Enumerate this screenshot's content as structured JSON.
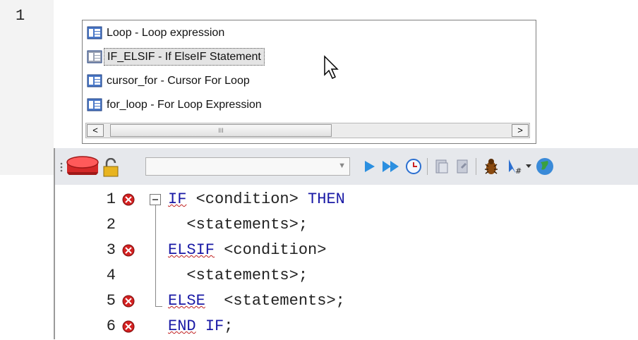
{
  "editor_top": {
    "line_number": "1"
  },
  "completion_list": {
    "items": [
      {
        "label": "Loop - Loop expression",
        "icon": "snippet-icon"
      },
      {
        "label": "IF_ELSIF - If ElseIF Statement",
        "icon": "snippet-icon",
        "selected": true
      },
      {
        "label": "cursor_for - Cursor For Loop",
        "icon": "snippet-icon"
      },
      {
        "label": "for_loop - For Loop Expression",
        "icon": "snippet-icon"
      }
    ],
    "scrollbar": {
      "left_arrow": "<",
      "right_arrow": ">",
      "thumb_grip": "III"
    }
  },
  "toolbar": {
    "icons": [
      "database-icon",
      "lock-icon",
      "run-icon",
      "run-all-icon",
      "history-icon",
      "commit-icon",
      "rollback-icon",
      "debug-bug-icon",
      "explain-plan-icon",
      "globe-icon"
    ],
    "combo_value": ""
  },
  "code_lines": [
    {
      "num": "1",
      "breakpoint": true,
      "parts": [
        {
          "t": "IF",
          "kw": true,
          "wavy": true
        },
        {
          "t": " <condition> "
        },
        {
          "t": "THEN",
          "kw": true
        }
      ]
    },
    {
      "num": "2",
      "breakpoint": false,
      "parts": [
        {
          "t": "  <statements>;"
        }
      ]
    },
    {
      "num": "3",
      "breakpoint": true,
      "parts": [
        {
          "t": "ELSIF",
          "kw": true,
          "wavy": true
        },
        {
          "t": " <condition>"
        }
      ]
    },
    {
      "num": "4",
      "breakpoint": false,
      "parts": [
        {
          "t": "  <statements>;"
        }
      ]
    },
    {
      "num": "5",
      "breakpoint": true,
      "parts": [
        {
          "t": "ELSE",
          "kw": true,
          "wavy": true
        },
        {
          "t": "  <statements>;"
        }
      ]
    },
    {
      "num": "6",
      "breakpoint": true,
      "parts": [
        {
          "t": "END",
          "kw": true,
          "wavy": true
        },
        {
          "t": " "
        },
        {
          "t": "IF",
          "kw": true
        },
        {
          "t": ";"
        }
      ]
    }
  ],
  "colors": {
    "keyword": "#1a1aa6",
    "breakpoint": "#d42020",
    "selection": "#e4e4e4"
  }
}
